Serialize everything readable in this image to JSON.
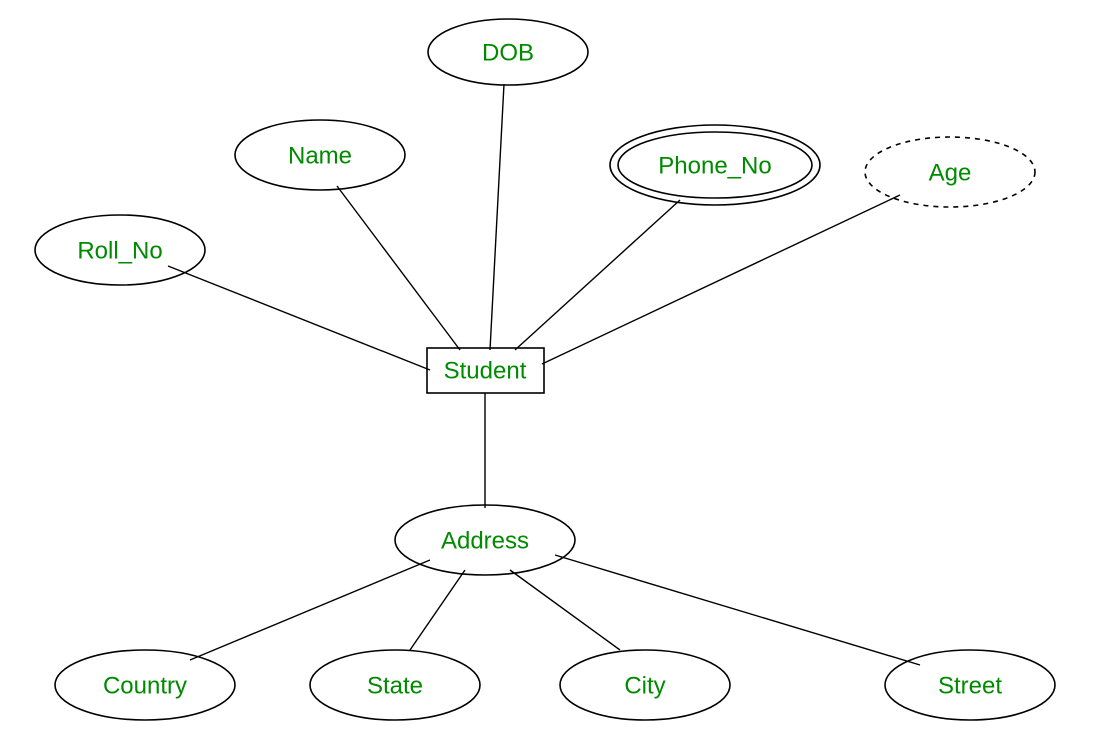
{
  "diagram": {
    "type": "er-diagram",
    "entity": {
      "name": "Student",
      "attributes": [
        {
          "key": "roll_no",
          "label": "Roll_No",
          "kind": "simple"
        },
        {
          "key": "name",
          "label": "Name",
          "kind": "simple"
        },
        {
          "key": "dob",
          "label": "DOB",
          "kind": "simple"
        },
        {
          "key": "phone_no",
          "label": "Phone_No",
          "kind": "multivalued"
        },
        {
          "key": "age",
          "label": "Age",
          "kind": "derived"
        },
        {
          "key": "address",
          "label": "Address",
          "kind": "composite",
          "components": [
            {
              "key": "country",
              "label": "Country"
            },
            {
              "key": "state",
              "label": "State"
            },
            {
              "key": "city",
              "label": "City"
            },
            {
              "key": "street",
              "label": "Street"
            }
          ]
        }
      ]
    },
    "colors": {
      "label": "#008a00",
      "stroke": "#000000",
      "background": "#ffffff"
    }
  }
}
